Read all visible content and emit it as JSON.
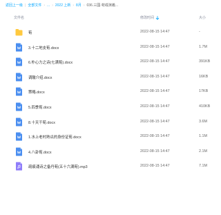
{
  "breadcrumb": {
    "items": [
      "返回上一级",
      "全部文件",
      "...",
      "2022 上新",
      "8月",
      "036.三國·荀彧演義..."
    ]
  },
  "header": {
    "name_label": "文件名",
    "time_label": "修改时间",
    "size_label": "大小"
  },
  "files": [
    {
      "type": "folder",
      "icon": "folder-icon",
      "name": "荀",
      "time": "2022-08-15 14:47",
      "size": "-"
    },
    {
      "type": "doc",
      "icon": "word-doc-icon",
      "name": "3.十二地支荀.docx",
      "time": "2022-08-15 14:47",
      "size": "1.7M"
    },
    {
      "type": "doc",
      "icon": "word-doc-icon",
      "name": "6.朴心力之诗(七满荀).docx",
      "time": "2022-08-15 14:47",
      "size": "391KB"
    },
    {
      "type": "doc",
      "icon": "word-doc-icon",
      "name": "调酸介绍.docx",
      "time": "2022-08-15 14:47",
      "size": "16KB"
    },
    {
      "type": "doc",
      "icon": "word-doc-icon",
      "name": "策略.docx",
      "time": "2022-08-15 14:47",
      "size": "17KB"
    },
    {
      "type": "doc",
      "icon": "word-doc-icon",
      "name": "5.四季荀.docx",
      "time": "2022-08-15 14:47",
      "size": "410KB"
    },
    {
      "type": "doc",
      "icon": "word-doc-icon",
      "name": "8.十天干荀.docx",
      "time": "2022-08-15 14:47",
      "size": "3.6M"
    },
    {
      "type": "doc",
      "icon": "word-doc-icon",
      "name": "1.水上老村熟瓜的身份证荀.docx",
      "time": "2022-08-15 14:47",
      "size": "1.1M"
    },
    {
      "type": "doc",
      "icon": "word-doc-icon",
      "name": "4.八卦荀.docx",
      "time": "2022-08-15 14:47",
      "size": "2.1M"
    },
    {
      "type": "audio",
      "icon": "audio-file-icon",
      "name": "疏痕诵诗之备丹荀(五十六满荀).mp3",
      "time": "2022-08-15 14:47",
      "size": "7.1M"
    }
  ],
  "colors": {
    "accent": "#06a7ff",
    "folder": "#ffc93f",
    "doc": "#4a8ef0",
    "audio": "#8f7dfa"
  }
}
